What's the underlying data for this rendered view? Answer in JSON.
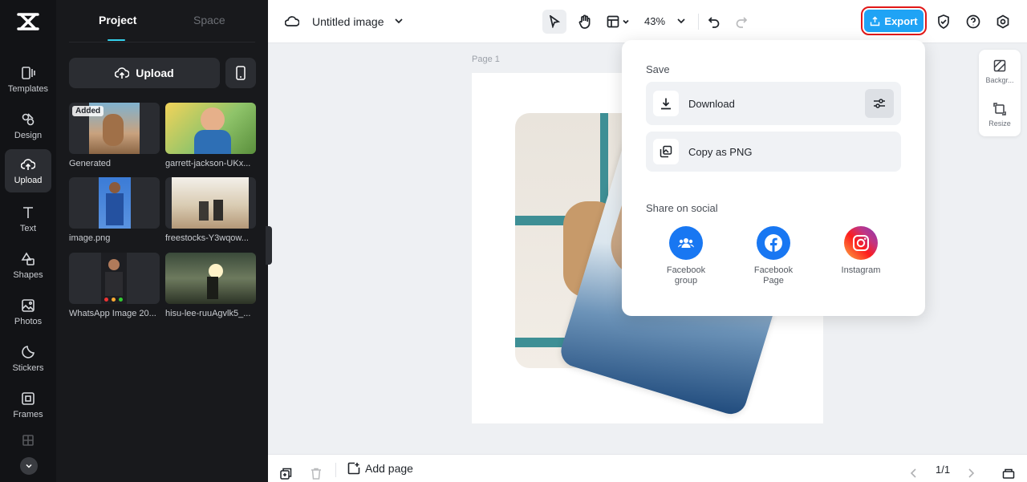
{
  "rail": {
    "items": [
      {
        "label": "Templates",
        "icon": "templates-icon"
      },
      {
        "label": "Design",
        "icon": "design-icon"
      },
      {
        "label": "Upload",
        "icon": "upload-cloud-icon",
        "active": true
      },
      {
        "label": "Text",
        "icon": "text-icon"
      },
      {
        "label": "Shapes",
        "icon": "shapes-icon"
      },
      {
        "label": "Photos",
        "icon": "photos-icon"
      },
      {
        "label": "Stickers",
        "icon": "stickers-icon"
      },
      {
        "label": "Frames",
        "icon": "frames-icon"
      }
    ]
  },
  "panel": {
    "tabs": [
      {
        "label": "Project",
        "active": true
      },
      {
        "label": "Space"
      }
    ],
    "upload_label": "Upload",
    "assets": [
      {
        "name": "Generated",
        "badge": "Added"
      },
      {
        "name": "garrett-jackson-UKx..."
      },
      {
        "name": "image.png"
      },
      {
        "name": "freestocks-Y3wqow..."
      },
      {
        "name": "WhatsApp Image 20..."
      },
      {
        "name": "hisu-lee-ruuAgvlk5_..."
      }
    ]
  },
  "topbar": {
    "title": "Untitled image",
    "zoom": "43%",
    "export_label": "Export"
  },
  "canvas": {
    "page_label": "Page 1",
    "background_label": "Backgr...",
    "resize_label": "Resize"
  },
  "bottombar": {
    "add_page_label": "Add page",
    "pager": "1/1"
  },
  "export_menu": {
    "save_heading": "Save",
    "download_label": "Download",
    "copy_label": "Copy as PNG",
    "share_heading": "Share on social",
    "social": [
      {
        "line1": "Facebook",
        "line2": "group",
        "color": "#1877f2"
      },
      {
        "line1": "Facebook",
        "line2": "Page",
        "color": "#1877f2"
      },
      {
        "line1": "Instagram",
        "line2": ""
      }
    ]
  },
  "colors": {
    "accent": "#1fa3f5",
    "highlight": "#e11818",
    "rail_bg": "#121316",
    "panel_bg": "#18191c"
  }
}
